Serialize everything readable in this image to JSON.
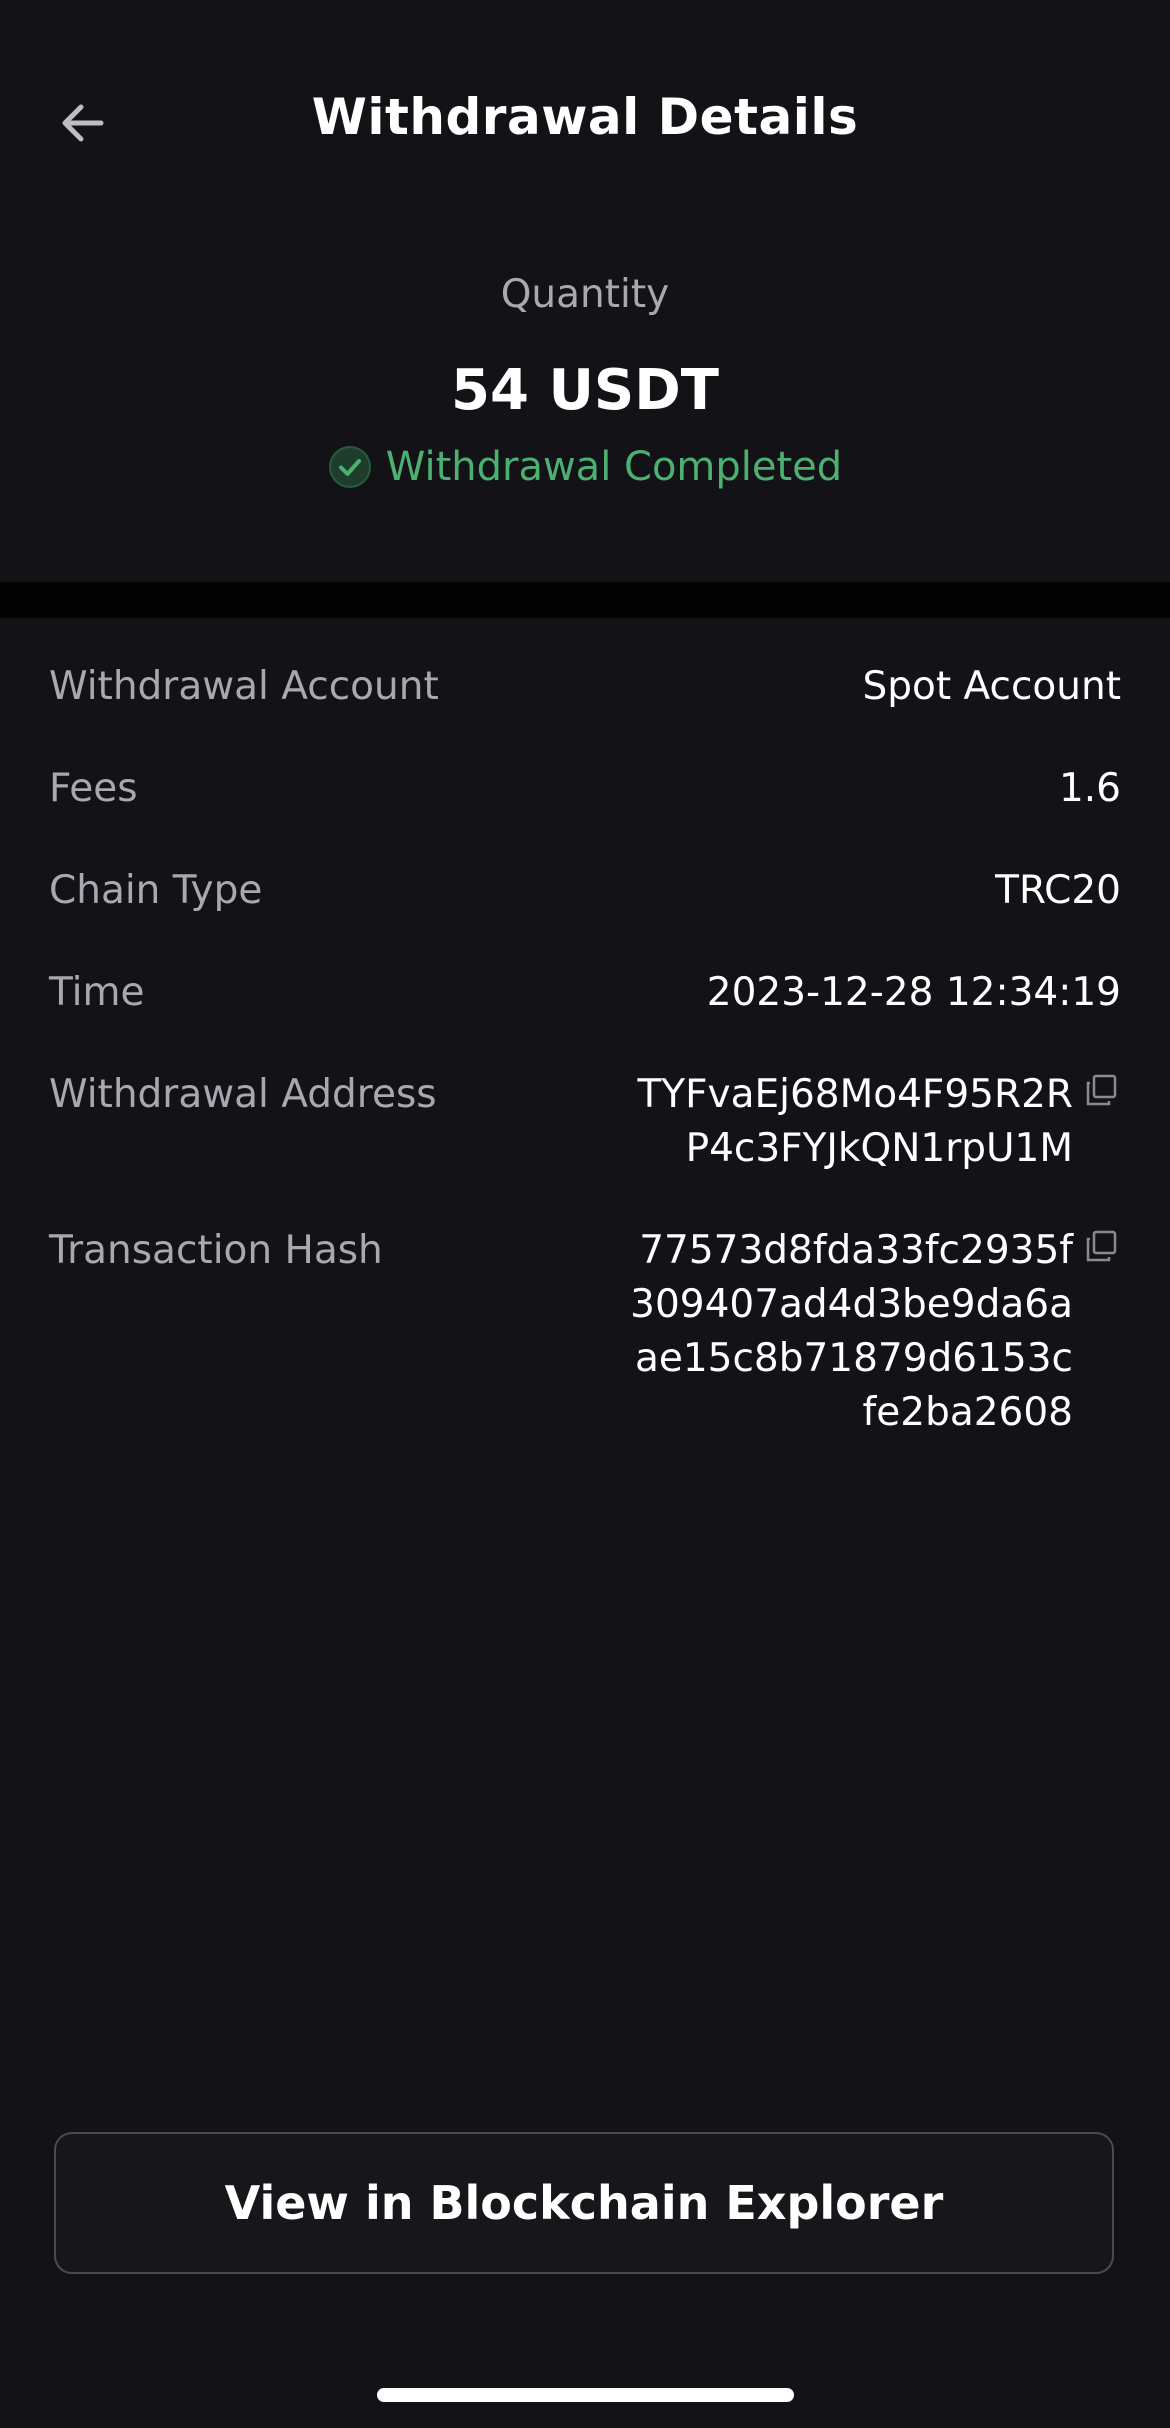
{
  "header": {
    "title": "Withdrawal Details",
    "back_icon": "arrow-left-icon"
  },
  "summary": {
    "quantity_label": "Quantity",
    "quantity_value": "54 USDT",
    "status_text": "Withdrawal Completed",
    "status_color": "#4cb070"
  },
  "details": {
    "account": {
      "label": "Withdrawal Account",
      "value": "Spot Account"
    },
    "fees": {
      "label": "Fees",
      "value": "1.6"
    },
    "chain": {
      "label": "Chain Type",
      "value": "TRC20"
    },
    "time": {
      "label": "Time",
      "value": "2023-12-28 12:34:19"
    },
    "address": {
      "label": "Withdrawal Address",
      "lines": [
        "TYFvaEj68Mo4F95R2R",
        "P4c3FYJkQN1rpU1M"
      ]
    },
    "hash": {
      "label": "Transaction Hash",
      "lines": [
        "77573d8fda33fc2935f",
        "309407ad4d3be9da6a",
        "ae15c8b71879d6153c",
        "fe2ba2608"
      ]
    }
  },
  "footer": {
    "explorer_button_label": "View in Blockchain Explorer"
  }
}
